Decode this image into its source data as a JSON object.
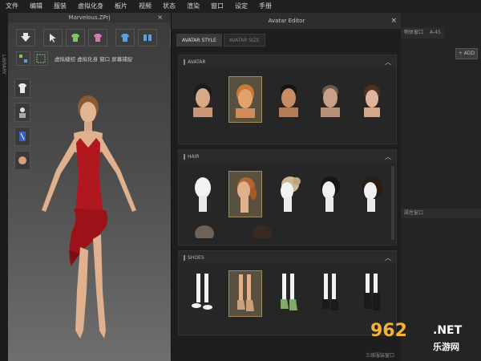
{
  "menu": [
    "文件",
    "编辑",
    "服装",
    "虚拟化身",
    "板片",
    "视频",
    "状态",
    "渲染",
    "窗口",
    "设定",
    "手册"
  ],
  "left_strip_text": "LIBRARY",
  "viewport": {
    "title": "Marvelous.ZPrj",
    "close": "×",
    "toolbar_text": "虚拟缝纫 虚拟化身 窗口 屏幕捕捉"
  },
  "editor": {
    "title": "Avatar Editor",
    "close": "×",
    "tabs": [
      "AVATAR STYLE",
      "AVATAR SIZE"
    ],
    "active_tab": 0,
    "sections": [
      {
        "label": "AVATAR",
        "items": [
          "avatar-face-1",
          "avatar-face-2",
          "avatar-face-3",
          "avatar-face-4",
          "avatar-face-5"
        ],
        "selected": 1
      },
      {
        "label": "HAIR",
        "items": [
          "hair-none",
          "hair-ponytail",
          "hair-bun",
          "hair-short-black",
          "hair-bob"
        ],
        "selected": 1
      },
      {
        "label": "SHOES",
        "items": [
          "shoes-bare",
          "shoes-heels-nude",
          "shoes-heels-green",
          "shoes-strappy-black",
          "shoes-boots-black"
        ],
        "selected": 1
      }
    ]
  },
  "right_panel": {
    "tabs": [
      "物体窗口",
      "A-45"
    ],
    "add_label": "+ ADD",
    "section2": "属性窗口"
  },
  "bottom_label": "三维服装窗口",
  "watermark": {
    "number": "962",
    "net": ".NET",
    "cn": "乐游网"
  },
  "colors": {
    "dress": "#b0171e",
    "selected_thumb": "#a08a60",
    "bg": "#1e1e1e",
    "wm_orange": "#f3b23a"
  }
}
